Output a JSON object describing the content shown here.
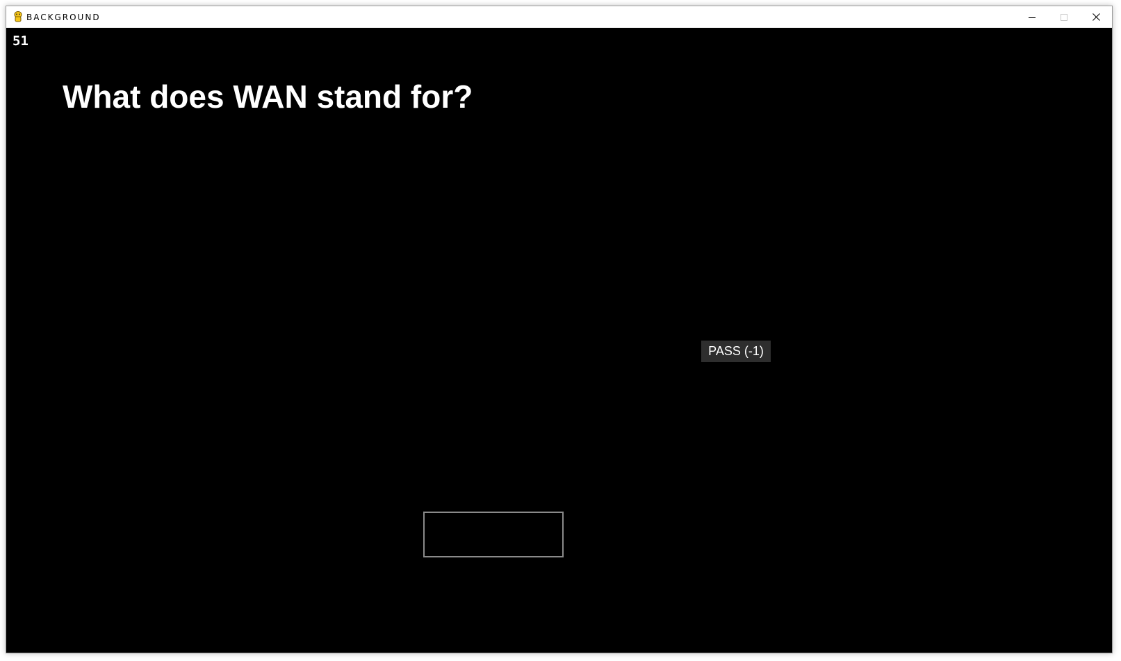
{
  "window": {
    "title": "BACKGROUND",
    "icon": "pygame-snake-icon",
    "controls": [
      "minimize",
      "maximize",
      "close"
    ]
  },
  "game": {
    "score": "51",
    "question": "What does WAN stand for?",
    "pass_label": "PASS (-1)",
    "answer_value": "",
    "background_color": "#000000",
    "text_color": "#ffffff",
    "pass_button_color": "#2e2e2e",
    "answer_border_color": "#8a8a8a"
  }
}
